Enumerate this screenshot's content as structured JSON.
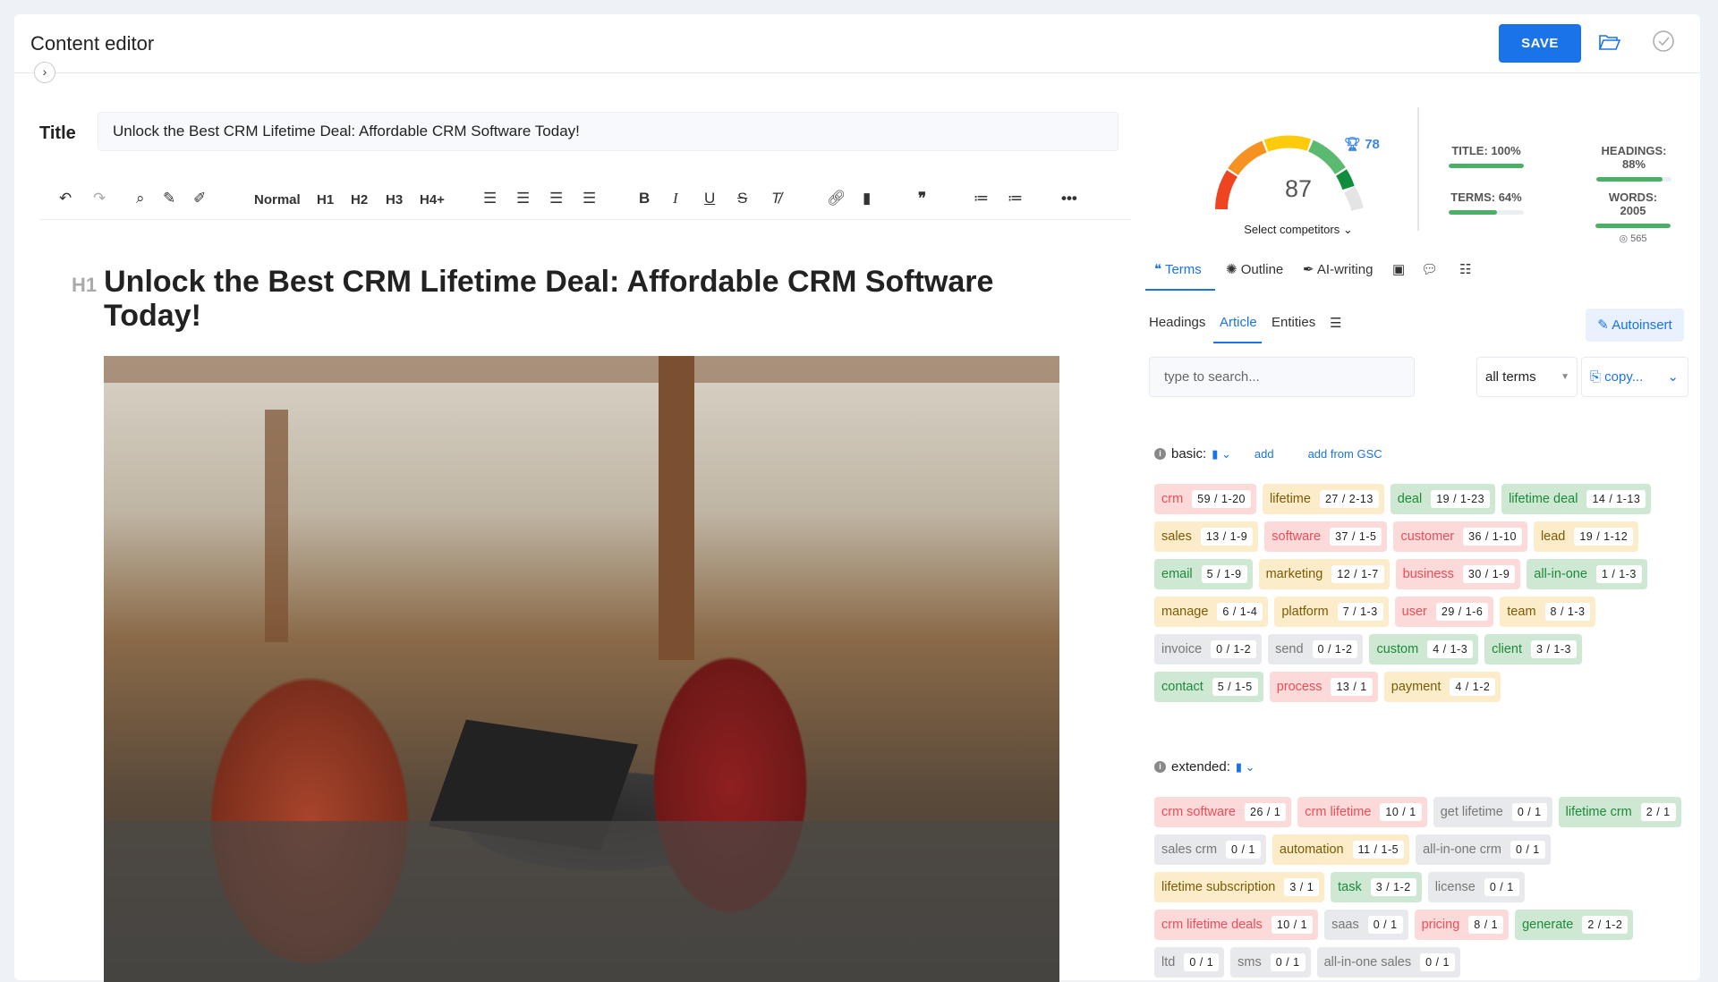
{
  "header": {
    "title": "Content editor",
    "save_label": "SAVE"
  },
  "title_field": {
    "label": "Title",
    "value": "Unlock the Best CRM Lifetime Deal: Affordable CRM Software Today!"
  },
  "toolbar": {
    "format": "Normal",
    "h1": "H1",
    "h2": "H2",
    "h3": "H3",
    "h4": "H4+"
  },
  "document": {
    "heading_tag": "H1",
    "heading": "Unlock the Best CRM Lifetime Deal: Affordable CRM Software Today!"
  },
  "score": {
    "value": "87",
    "competitor": "78",
    "select_competitors": "Select competitors",
    "value_num": 87
  },
  "stats": {
    "title": "TITLE: 100%",
    "title_pct": 100,
    "headings": "HEADINGS: 88%",
    "headings_pct": 88,
    "terms": "TERMS: 64%",
    "terms_pct": 64,
    "words": "WORDS: 2005",
    "words_pct": 100,
    "target": "565"
  },
  "tabs": [
    "Terms",
    "Outline",
    "AI-writing"
  ],
  "subtabs": [
    "Headings",
    "Article",
    "Entities"
  ],
  "autoinsert": "Autoinsert",
  "search": {
    "placeholder": "type to search...",
    "filter": "all terms",
    "copy": "copy..."
  },
  "basic": {
    "label": "basic:",
    "add": "add",
    "add_gsc": "add from GSC",
    "terms": [
      [
        "crm",
        "59 / 1-20",
        "red"
      ],
      [
        "lifetime",
        "27 / 2-13",
        "yel"
      ],
      [
        "deal",
        "19 / 1-23",
        "grn"
      ],
      [
        "lifetime deal",
        "14 / 1-13",
        "grn"
      ],
      [
        "sales",
        "13 / 1-9",
        "yel"
      ],
      [
        "software",
        "37 / 1-5",
        "red"
      ],
      [
        "customer",
        "36 / 1-10",
        "red"
      ],
      [
        "lead",
        "19 / 1-12",
        "yel"
      ],
      [
        "email",
        "5 / 1-9",
        "grn"
      ],
      [
        "marketing",
        "12 / 1-7",
        "yel"
      ],
      [
        "business",
        "30 / 1-9",
        "red"
      ],
      [
        "all-in-one",
        "1 / 1-3",
        "grn"
      ],
      [
        "manage",
        "6 / 1-4",
        "yel"
      ],
      [
        "platform",
        "7 / 1-3",
        "yel"
      ],
      [
        "user",
        "29 / 1-6",
        "red"
      ],
      [
        "team",
        "8 / 1-3",
        "yel"
      ],
      [
        "invoice",
        "0 / 1-2",
        "gry"
      ],
      [
        "send",
        "0 / 1-2",
        "gry"
      ],
      [
        "custom",
        "4 / 1-3",
        "grn"
      ],
      [
        "client",
        "3 / 1-3",
        "grn"
      ],
      [
        "contact",
        "5 / 1-5",
        "grn"
      ],
      [
        "process",
        "13 / 1",
        "red"
      ],
      [
        "payment",
        "4 / 1-2",
        "yel"
      ]
    ]
  },
  "extended": {
    "label": "extended:",
    "terms": [
      [
        "crm software",
        "26 / 1",
        "red"
      ],
      [
        "crm lifetime",
        "10 / 1",
        "red"
      ],
      [
        "get lifetime",
        "0 / 1",
        "gry"
      ],
      [
        "lifetime crm",
        "2 / 1",
        "grn"
      ],
      [
        "sales crm",
        "0 / 1",
        "gry"
      ],
      [
        "automation",
        "11 / 1-5",
        "yel"
      ],
      [
        "all-in-one crm",
        "0 / 1",
        "gry"
      ],
      [
        "lifetime subscription",
        "3 / 1",
        "yel"
      ],
      [
        "task",
        "3 / 1-2",
        "grn"
      ],
      [
        "license",
        "0 / 1",
        "gry"
      ],
      [
        "crm lifetime deals",
        "10 / 1",
        "red"
      ],
      [
        "saas",
        "0 / 1",
        "gry"
      ],
      [
        "pricing",
        "8 / 1",
        "red"
      ],
      [
        "generate",
        "2 / 1-2",
        "grn"
      ],
      [
        "ltd",
        "0 / 1",
        "gry"
      ],
      [
        "sms",
        "0 / 1",
        "gry"
      ],
      [
        "all-in-one sales",
        "0 / 1",
        "gry"
      ]
    ]
  }
}
